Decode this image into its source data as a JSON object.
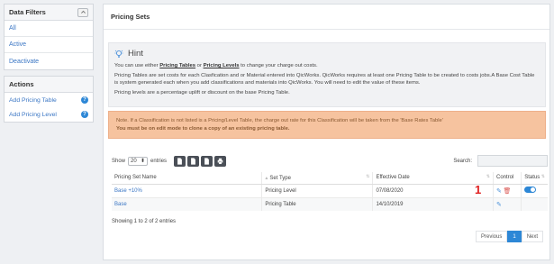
{
  "sidebar": {
    "filters_title": "Data Filters",
    "filters": [
      {
        "label": "All"
      },
      {
        "label": "Active"
      },
      {
        "label": "Deactivate"
      }
    ],
    "actions_title": "Actions",
    "actions": [
      {
        "label": "Add Pricing Table"
      },
      {
        "label": "Add Pricing Level"
      }
    ]
  },
  "main": {
    "title": "Pricing Sets",
    "hint": {
      "title": "Hint",
      "line1_pre": "You can use either ",
      "line1_link1": "Pricing Tables",
      "line1_mid": " or ",
      "line1_link2": "Pricing Levels",
      "line1_post": " to change your charge out costs.",
      "line2": "Pricing Tables are set costs for each Clasfication and or Material entered into QicWorks. QicWorks requires at least one Pricing Table to be created to costs jobs.A Base Cost Table is system generated each when you add classifications and materials into QicWorks. You will need to edit the value of these items.",
      "line3": "Pricing levels are a percentage uplift or discount on the base Pricing Table."
    },
    "note": {
      "line1": "Note. If a Classification is not listed is a Pricing/Level Table, the charge out rate for this Classification will be taken from the 'Base Rates Table'",
      "line2": "You must be on edit mode to clone a copy of an existing pricing table."
    },
    "toolbar": {
      "show_label": "Show",
      "entries_value": "20",
      "entries_label": "entries",
      "search_label": "Search:"
    },
    "table": {
      "headers": [
        "Pricing Set Name",
        "Set Type",
        "Effective Date",
        "Control",
        "Status"
      ],
      "rows": [
        {
          "name": "Base +10%",
          "type": "Pricing Level",
          "date": "07/08/2020"
        },
        {
          "name": "Base",
          "type": "Pricing Table",
          "date": "14/10/2019"
        }
      ]
    },
    "annotation": "1",
    "info": "Showing 1 to 2 of 2 entries",
    "pager": {
      "prev": "Previous",
      "current": "1",
      "next": "Next"
    }
  }
}
